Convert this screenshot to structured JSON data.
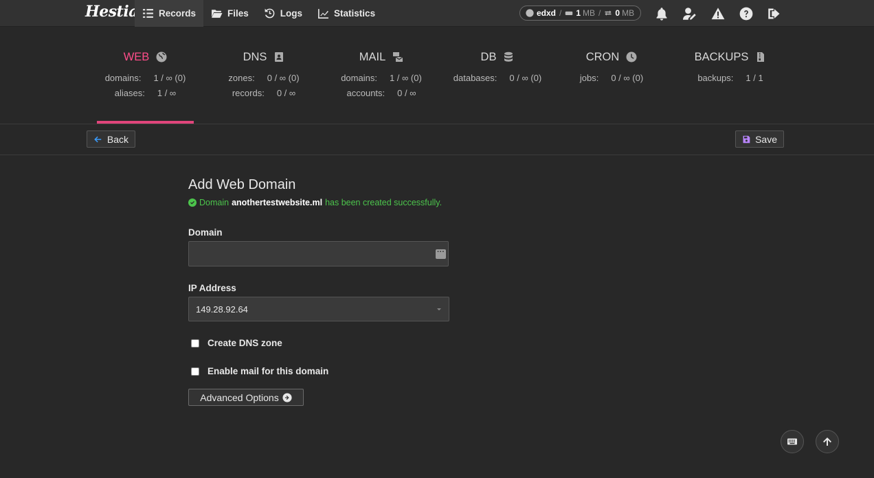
{
  "app": {
    "logo_text": "Hestia"
  },
  "nav": [
    {
      "label": "Records",
      "icon": "list-check-icon",
      "active": true
    },
    {
      "label": "Files",
      "icon": "folder-open-icon"
    },
    {
      "label": "Logs",
      "icon": "history-icon"
    },
    {
      "label": "Statistics",
      "icon": "chart-line-icon"
    }
  ],
  "user": {
    "name": "edxd",
    "disk_value": "1",
    "disk_unit": "MB",
    "bw_value": "0",
    "bw_unit": "MB"
  },
  "stats": [
    {
      "title": "WEB",
      "icon": "globe-icon",
      "rows": [
        {
          "k": "domains:",
          "v": "1 / ∞ (0)"
        },
        {
          "k": "aliases:",
          "v": "1 / ∞"
        }
      ]
    },
    {
      "title": "DNS",
      "icon": "address-book-icon",
      "rows": [
        {
          "k": "zones:",
          "v": "0 / ∞ (0)"
        },
        {
          "k": "records:",
          "v": "0 / ∞"
        }
      ]
    },
    {
      "title": "MAIL",
      "icon": "mail-bulk-icon",
      "rows": [
        {
          "k": "domains:",
          "v": "1 / ∞ (0)"
        },
        {
          "k": "accounts:",
          "v": "0 / ∞"
        }
      ]
    },
    {
      "title": "DB",
      "icon": "database-icon",
      "rows": [
        {
          "k": "databases:",
          "v": "0 / ∞ (0)"
        }
      ]
    },
    {
      "title": "CRON",
      "icon": "clock-icon",
      "rows": [
        {
          "k": "jobs:",
          "v": "0 / ∞ (0)"
        }
      ]
    },
    {
      "title": "BACKUPS",
      "icon": "file-archive-icon",
      "rows": [
        {
          "k": "backups:",
          "v": "1 / 1"
        }
      ]
    }
  ],
  "toolbar": {
    "back_label": "Back",
    "save_label": "Save"
  },
  "form": {
    "title": "Add Web Domain",
    "alert_prefix": "Domain",
    "alert_domain": "anothertestwebsite.ml",
    "alert_suffix": "has been created successfully.",
    "domain_label": "Domain",
    "domain_value": "",
    "ip_label": "IP Address",
    "ip_value": "149.28.92.64",
    "dns_label": "Create DNS zone",
    "mail_label": "Enable mail for this domain",
    "advanced_label": "Advanced Options"
  },
  "colors": {
    "accent": "#e0457b",
    "success": "#4cc44c",
    "back_arrow": "#3b9cff",
    "save_icon": "#b985ff"
  }
}
